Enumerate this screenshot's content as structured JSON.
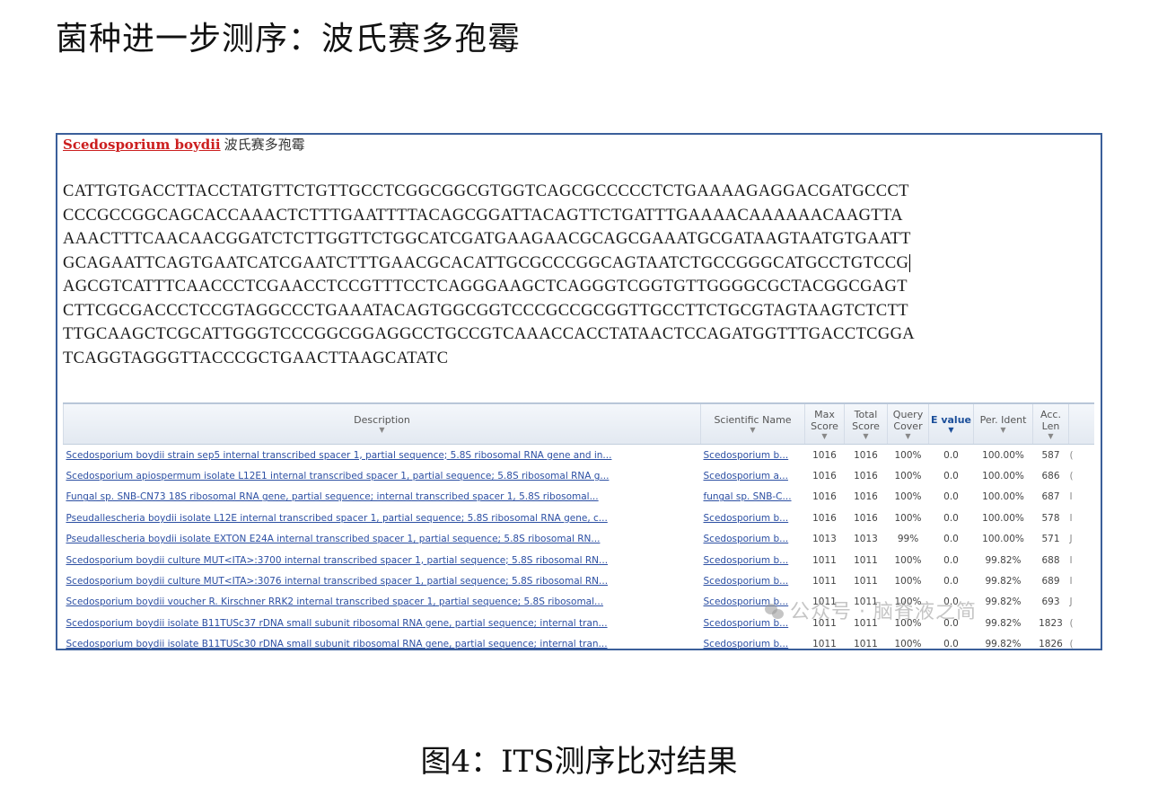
{
  "page": {
    "title": "菌种进一步测序：波氏赛多孢霉",
    "caption": "图4：ITS测序比对结果",
    "watermark": "公众号 · 脑脊液之简"
  },
  "colors": {
    "species_latin": "#cc1f1f",
    "frame_border": "#3b5f9a",
    "link_blue": "#2c4fa3",
    "active_sort": "#1c4f9a"
  },
  "species": {
    "latin": "Scedosporium boydii",
    "chinese": "波氏赛多孢霉"
  },
  "sequence_lines": [
    "CATTGTGACCTTACCTATGTTCTGTTGCCTCGGCGGCGTGGTCAGCGCCCCCTCTGAAAAGAGGACGATGCCCT",
    "CCCGCCGGCAGCACCAAACTCTTTGAATTTTACAGCGGATTACAGTTCTGATTTGAAAACAAAAAACAAGTTA",
    "AAACTTTCAACAACGGATCTCTTGGTTCTGGCATCGATGAAGAACGCAGCGAAATGCGATAAGTAATGTGAATT",
    "GCAGAATTCAGTGAATCATCGAATCTTTGAACGCACATTGCGCCCGGCAGTAATCTGCCGGGCATGCCTGTCCG",
    "AGCGTCATTTCAACCCTCGAACCTCCGTTTCCTCAGGGAAGCTCAGGGTCGGTGTTGGGGCGCTACGGCGAGT",
    "CTTCGCGACCCTCCGTAGGCCCTGAAATACAGTGGCGGTCCCGCCGCGGTTGCCTTCTGCGTAGTAAGTCTCTT",
    "TTGCAAGCTCGCATTGGGTCCCGGCGGAGGCCTGCCGTCAAACCACCTATAACTCCAGATGGTTTGACCTCGGA",
    "TCAGGTAGGGTTACCCGCTGAACTTAAGCATATC"
  ],
  "table": {
    "headers": {
      "description": "Description",
      "scientific_name": "Scientific Name",
      "max_score": "Max Score",
      "total_score": "Total Score",
      "query_cover": "Query Cover",
      "e_value": "E value",
      "per_ident": "Per. Ident",
      "acc_len": "Acc. Len"
    },
    "rows": [
      {
        "description": "Scedosporium boydii strain sep5 internal transcribed spacer 1, partial sequence; 5.8S ribosomal RNA gene and in...",
        "scientific_name": "Scedosporium b...",
        "max_score": "1016",
        "total_score": "1016",
        "query_cover": "100%",
        "e_value": "0.0",
        "per_ident": "100.00%",
        "acc_len": "587",
        "extra": "("
      },
      {
        "description": "Scedosporium apiospermum isolate L12E1 internal transcribed spacer 1, partial sequence; 5.8S ribosomal RNA g...",
        "scientific_name": "Scedosporium a...",
        "max_score": "1016",
        "total_score": "1016",
        "query_cover": "100%",
        "e_value": "0.0",
        "per_ident": "100.00%",
        "acc_len": "686",
        "extra": "("
      },
      {
        "description": "Fungal sp. SNB-CN73 18S ribosomal RNA gene, partial sequence; internal transcribed spacer 1, 5.8S ribosomal...",
        "scientific_name": "fungal sp. SNB-C...",
        "max_score": "1016",
        "total_score": "1016",
        "query_cover": "100%",
        "e_value": "0.0",
        "per_ident": "100.00%",
        "acc_len": "687",
        "extra": "I"
      },
      {
        "description": "Pseudallescheria boydii isolate L12E internal transcribed spacer 1, partial sequence; 5.8S ribosomal RNA gene, c...",
        "scientific_name": "Scedosporium b...",
        "max_score": "1016",
        "total_score": "1016",
        "query_cover": "100%",
        "e_value": "0.0",
        "per_ident": "100.00%",
        "acc_len": "578",
        "extra": "I"
      },
      {
        "description": "Pseudallescheria boydii isolate EXTON E24A internal transcribed spacer 1, partial sequence; 5.8S ribosomal RN...",
        "scientific_name": "Scedosporium b...",
        "max_score": "1013",
        "total_score": "1013",
        "query_cover": "99%",
        "e_value": "0.0",
        "per_ident": "100.00%",
        "acc_len": "571",
        "extra": "J"
      },
      {
        "description": "Scedosporium boydii culture MUT<ITA>:3700 internal transcribed spacer 1, partial sequence; 5.8S ribosomal RN...",
        "scientific_name": "Scedosporium b...",
        "max_score": "1011",
        "total_score": "1011",
        "query_cover": "100%",
        "e_value": "0.0",
        "per_ident": "99.82%",
        "acc_len": "688",
        "extra": "I"
      },
      {
        "description": "Scedosporium boydii culture MUT<ITA>:3076 internal transcribed spacer 1, partial sequence; 5.8S ribosomal RN...",
        "scientific_name": "Scedosporium b...",
        "max_score": "1011",
        "total_score": "1011",
        "query_cover": "100%",
        "e_value": "0.0",
        "per_ident": "99.82%",
        "acc_len": "689",
        "extra": "I"
      },
      {
        "description": "Scedosporium boydii voucher R. Kirschner RRK2 internal transcribed spacer 1, partial sequence; 5.8S ribosomal...",
        "scientific_name": "Scedosporium b...",
        "max_score": "1011",
        "total_score": "1011",
        "query_cover": "100%",
        "e_value": "0.0",
        "per_ident": "99.82%",
        "acc_len": "693",
        "extra": "J"
      },
      {
        "description": "Scedosporium boydii isolate B11TUSc37 rDNA small subunit ribosomal RNA gene, partial sequence; internal tran...",
        "scientific_name": "Scedosporium b...",
        "max_score": "1011",
        "total_score": "1011",
        "query_cover": "100%",
        "e_value": "0.0",
        "per_ident": "99.82%",
        "acc_len": "1823",
        "extra": "("
      },
      {
        "description": "Scedosporium boydii isolate B11TUSc30 rDNA small subunit ribosomal RNA gene, partial sequence; internal tran...",
        "scientific_name": "Scedosporium b...",
        "max_score": "1011",
        "total_score": "1011",
        "query_cover": "100%",
        "e_value": "0.0",
        "per_ident": "99.82%",
        "acc_len": "1826",
        "extra": "("
      }
    ]
  }
}
